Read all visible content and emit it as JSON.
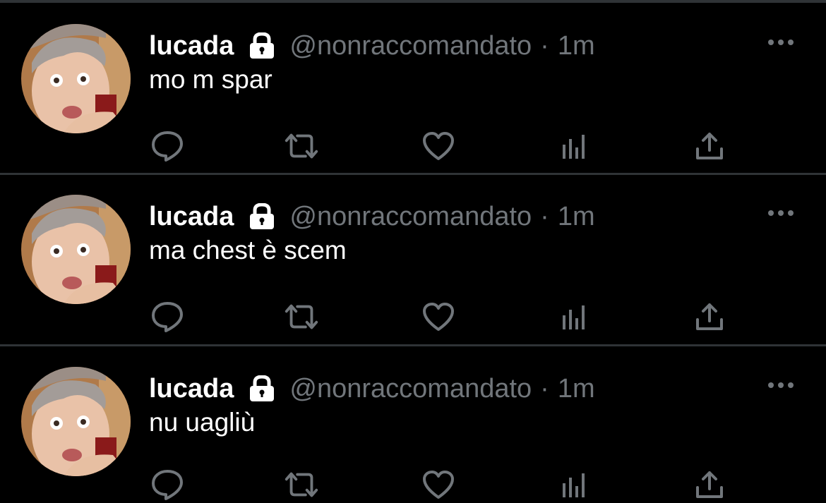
{
  "theme": {
    "background": "#000000",
    "divider": "#2f3336",
    "text_primary": "#ffffff",
    "text_secondary": "#71767b",
    "icon": "#71767b"
  },
  "tweets": [
    {
      "display_name": "lucada",
      "protected_icon": "lock-icon",
      "handle": "@nonraccomandato",
      "separator": "·",
      "time": "1m",
      "text": "mo m spar",
      "actions": [
        "reply-icon",
        "retweet-icon",
        "like-icon",
        "analytics-icon",
        "share-icon"
      ]
    },
    {
      "display_name": "lucada",
      "protected_icon": "lock-icon",
      "handle": "@nonraccomandato",
      "separator": "·",
      "time": "1m",
      "text": "ma chest è scem",
      "actions": [
        "reply-icon",
        "retweet-icon",
        "like-icon",
        "analytics-icon",
        "share-icon"
      ]
    },
    {
      "display_name": "lucada",
      "protected_icon": "lock-icon",
      "handle": "@nonraccomandato",
      "separator": "·",
      "time": "1m",
      "text": "nu uagliù",
      "actions": [
        "reply-icon",
        "retweet-icon",
        "like-icon",
        "analytics-icon",
        "share-icon"
      ]
    }
  ]
}
